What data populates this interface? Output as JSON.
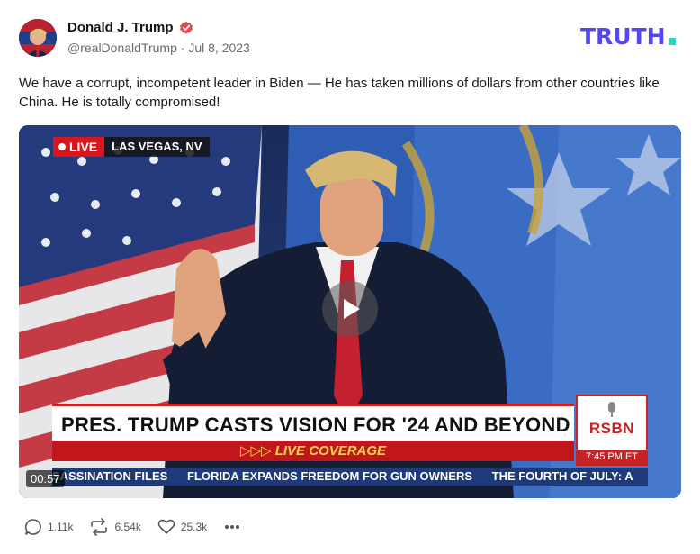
{
  "author": {
    "display_name": "Donald J. Trump",
    "handle": "@realDonaldTrump",
    "separator": "·",
    "date": "Jul 8, 2023",
    "verified_icon": "verified-badge-icon",
    "verified_color": "#e5484d"
  },
  "brand": {
    "logo_text": "TRUTH.",
    "color_primary": "#5448ee",
    "color_dot": "#37d4c4"
  },
  "post": {
    "text": "We have a corrupt, incompetent leader in Biden — He has taken millions of dollars from other countries like China. He is totally compromised!"
  },
  "video": {
    "live_label": "LIVE",
    "location": "LAS VEGAS, NV",
    "headline": "PRES. TRUMP CASTS VISION FOR '24 AND BEYOND",
    "subline": "▷▷▷ LIVE COVERAGE",
    "network": "RSBN",
    "network_time": "7:45 PM ET",
    "ticker_items": [
      "SASSINATION FILES",
      "FLORIDA EXPANDS FREEDOM FOR GUN OWNERS",
      "THE FOURTH OF JULY: A"
    ],
    "duration": "00:57",
    "play_icon": "play-icon"
  },
  "actions": {
    "replies": "1.11k",
    "retruths": "6.54k",
    "likes": "25.3k",
    "reply_icon": "comment-icon",
    "retruth_icon": "retruth-icon",
    "like_icon": "heart-icon",
    "more_icon": "more-dots-icon"
  }
}
